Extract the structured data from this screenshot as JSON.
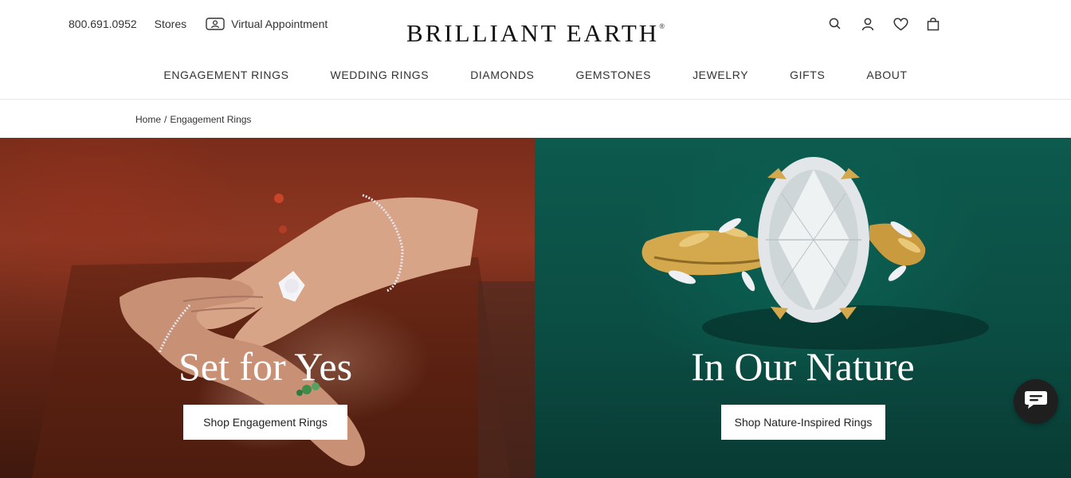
{
  "utility": {
    "phone": "800.691.0952",
    "stores": "Stores",
    "appointment": "Virtual Appointment"
  },
  "logo": {
    "text": "BRILLIANT EARTH",
    "mark": "®"
  },
  "header_icons": [
    "search-icon",
    "account-icon",
    "heart-icon",
    "bag-icon"
  ],
  "nav": {
    "items": [
      {
        "label": "ENGAGEMENT RINGS"
      },
      {
        "label": "WEDDING RINGS"
      },
      {
        "label": "DIAMONDS"
      },
      {
        "label": "GEMSTONES"
      },
      {
        "label": "JEWELRY"
      },
      {
        "label": "GIFTS"
      },
      {
        "label": "ABOUT"
      }
    ]
  },
  "breadcrumb": {
    "home": "Home",
    "separator": "/",
    "current": "Engagement Rings"
  },
  "hero": {
    "left": {
      "title": "Set for Yes",
      "cta": "Shop Engagement Rings"
    },
    "right": {
      "title": "In Our Nature",
      "cta": "Shop Nature-Inspired Rings"
    }
  },
  "colors": {
    "left_panel": "#7a2c1a",
    "right_panel": "#0b4c42",
    "gold": "#d4a94e",
    "chat_button": "#1f1f1f"
  },
  "chat_icon": "chat-bubble-icon"
}
